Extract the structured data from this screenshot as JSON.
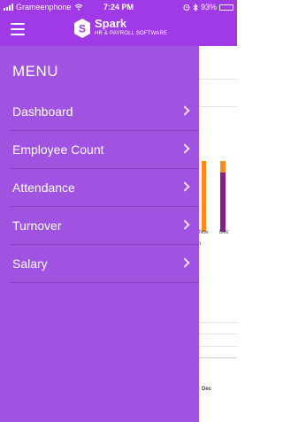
{
  "status_bar": {
    "carrier": "Grameenphone",
    "time": "7:24 PM",
    "battery": "93%",
    "battery_level": 0.93
  },
  "app_bar": {
    "brand_name": "Spark",
    "brand_tagline": "HR & PAYROLL SOFTWARE"
  },
  "menu": {
    "title": "MENU",
    "items": [
      {
        "label": "Dashboard"
      },
      {
        "label": "Employee Count"
      },
      {
        "label": "Attendance"
      },
      {
        "label": "Turnover"
      },
      {
        "label": "Salary"
      }
    ]
  },
  "background": {
    "chart_labels": [
      "Nov",
      "Dec"
    ],
    "partial_label": "h",
    "lower_label": "Dec",
    "colors": {
      "orange": "#ff8c1a",
      "purple": "#8b1e8b"
    }
  }
}
